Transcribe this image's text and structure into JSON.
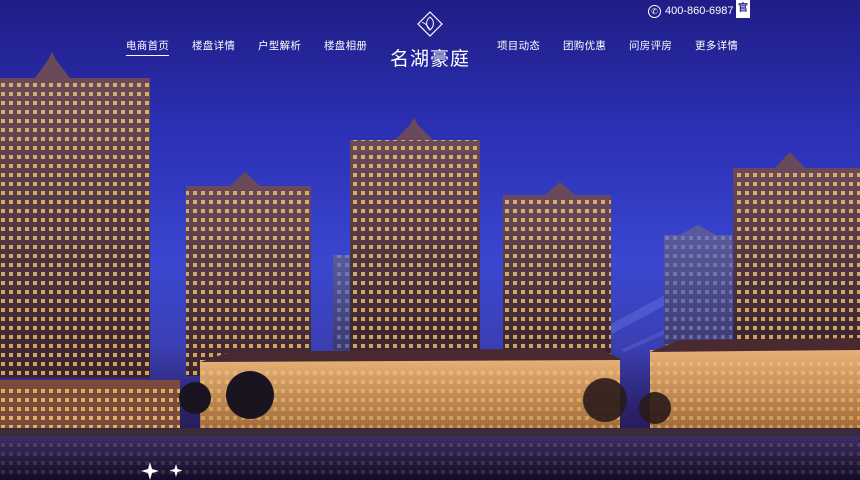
{
  "nav": {
    "left": [
      {
        "label": "电商首页",
        "active": true
      },
      {
        "label": "楼盘详情",
        "active": false
      },
      {
        "label": "户型解析",
        "active": false
      },
      {
        "label": "楼盘相册",
        "active": false
      }
    ],
    "right": [
      {
        "label": "项目动态"
      },
      {
        "label": "团购优惠"
      },
      {
        "label": "问房评房"
      },
      {
        "label": "更多详情"
      }
    ]
  },
  "logo": {
    "name": "名湖豪庭",
    "icon": "flower-emblem-icon"
  },
  "contact": {
    "phone": "400-860-6987",
    "phone_icon": "phone-icon",
    "badge": "官"
  },
  "colors": {
    "sky_top": "#1f1d86",
    "sky_mid": "#3a47cf",
    "water": "#1a1238",
    "window_light": "#ffcf6a"
  }
}
